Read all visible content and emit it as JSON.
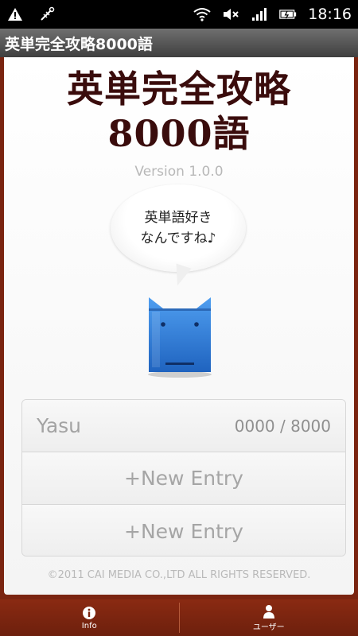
{
  "status_bar": {
    "time": "18:16",
    "icons": [
      "warning-icon",
      "usb-debug-icon",
      "wifi-icon",
      "mute-icon",
      "signal-icon",
      "battery-icon"
    ]
  },
  "title_bar": {
    "title": "英単完全攻略8000語"
  },
  "main": {
    "app_title_line1": "英単完全攻略",
    "app_title_line2": "8000語",
    "version": "Version 1.0.0",
    "bubble_line1": "英単語好き",
    "bubble_line2": "なんですね♪",
    "mascot": "blue-cat-mascot"
  },
  "users": [
    {
      "name": "Yasu",
      "progress": "0000 / 8000"
    }
  ],
  "new_entries": [
    {
      "label": "+New Entry"
    },
    {
      "label": "+New Entry"
    }
  ],
  "copyright": "©2011 CAI MEDIA CO.,LTD ALL RIGHTS RESERVED.",
  "bottom_bar": {
    "info_label": "Info",
    "user_label": "ユーザー"
  },
  "colors": {
    "background": "#7a2410",
    "title_text": "#3a0c0c",
    "mascot_blue": "#2f7fd8"
  }
}
